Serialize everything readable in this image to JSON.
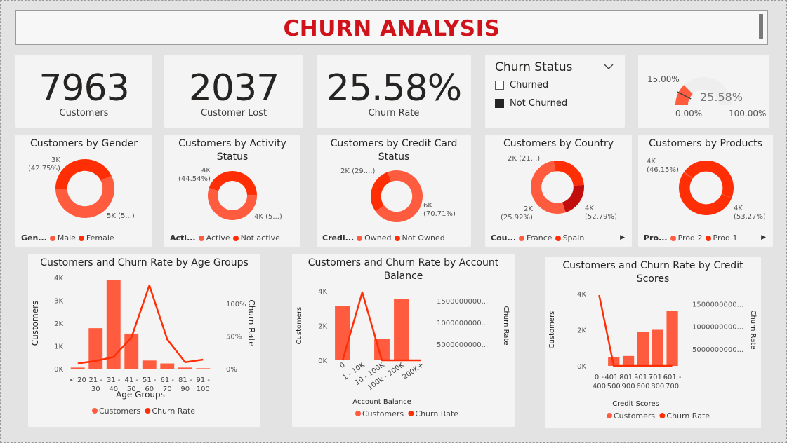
{
  "header": {
    "title": "CHURN ANALYSIS"
  },
  "colors": {
    "accent": "#ff5b3f",
    "accent_dark": "#ff2e05",
    "dark_red": "#c20d0d",
    "title_red": "#d0121b"
  },
  "kpis": [
    {
      "value": "7963",
      "label": "Customers"
    },
    {
      "value": "2037",
      "label": "Customer Lost"
    },
    {
      "value": "25.58%",
      "label": "Churn Rate"
    }
  ],
  "slicer": {
    "title": "Churn Status",
    "chevron_icon": "chevron-down-icon",
    "options": [
      {
        "label": "Churned",
        "selected": false
      },
      {
        "label": "Not Churned",
        "selected": true
      }
    ]
  },
  "gauge": {
    "target_label": "15.00%",
    "value_label": "25.58%",
    "min_label": "0.00%",
    "max_label": "100.00%",
    "value": 25.58,
    "target": 15,
    "min": 0,
    "max": 100
  },
  "more_options": "⋯",
  "donuts": [
    {
      "title": "Customers by Gender",
      "legend_title": "Gen...",
      "legend": [
        "Male",
        "Female"
      ],
      "labels": [
        "3K\n(42.75%)",
        "5K (5...)"
      ],
      "values": [
        42.75,
        57.25
      ]
    },
    {
      "title": "Customers by Activity Status",
      "legend_title": "Acti...",
      "legend": [
        "Active",
        "Not active"
      ],
      "labels": [
        "4K\n(44.54%)",
        "4K (5...)"
      ],
      "values": [
        44.54,
        55.46
      ]
    },
    {
      "title": "Customers by Credit Card Status",
      "legend_title": "Credi...",
      "legend": [
        "Owned",
        "Not Owned"
      ],
      "labels": [
        "2K (29....)",
        "6K\n(70.71%)"
      ],
      "values": [
        29.29,
        70.71
      ]
    },
    {
      "title": "Customers by Country",
      "legend_title": "Cou...",
      "legend": [
        "France",
        "Spain"
      ],
      "labels": [
        "2K (21...)",
        "2K\n(25.92%)",
        "4K\n(52.79%)"
      ],
      "values": [
        52.79,
        25.92,
        21.29
      ]
    },
    {
      "title": "Customers by Products",
      "legend_title": "Pro...",
      "legend": [
        "Prod 2",
        "Prod 1"
      ],
      "labels": [
        "4K\n(46.15%)",
        "4K\n(53.27%)"
      ],
      "values": [
        46.15,
        53.27,
        0.58
      ]
    }
  ],
  "chart_data": [
    {
      "type": "bar",
      "title": "Customers and Churn Rate by Age Groups",
      "xlabel": "Age Groups",
      "ylabel": "Customers",
      "y2label": "Churn Rate",
      "categories": [
        "< 20",
        "21 - 30",
        "31 - 40",
        "41 - 50",
        "51 - 60",
        "61 - 70",
        "81 - 90",
        "91 - 100"
      ],
      "yticks": [
        "0K",
        "1K",
        "2K",
        "3K",
        "4K"
      ],
      "y2ticks": [
        "0%",
        "50%",
        "100%"
      ],
      "ylim": [
        0,
        4000
      ],
      "y2lim": [
        0,
        140
      ],
      "series": [
        {
          "name": "Customers",
          "kind": "bar",
          "values": [
            50,
            1780,
            3900,
            1540,
            360,
            230,
            50,
            20
          ]
        },
        {
          "name": "Churn Rate",
          "kind": "line",
          "values": [
            8,
            12,
            18,
            48,
            128,
            45,
            10,
            14
          ]
        }
      ],
      "legend": [
        "Customers",
        "Churn Rate"
      ]
    },
    {
      "type": "bar",
      "title": "Customers and Churn Rate by Account Balance",
      "xlabel": "Account Balance",
      "ylabel": "Customers",
      "y2label": "Churn Rate",
      "categories": [
        "0",
        "1 - 10K",
        "10 - 100K",
        "100k - 200K",
        "200K+"
      ],
      "yticks": [
        "0K",
        "2K",
        "4K"
      ],
      "y2ticks": [
        "5000000000...",
        "1000000000...",
        "1500000000..."
      ],
      "ylim": [
        0,
        4000
      ],
      "series": [
        {
          "name": "Customers",
          "kind": "bar",
          "values": [
            3150,
            0,
            1250,
            3550,
            0
          ]
        },
        {
          "name": "Churn Rate",
          "kind": "line",
          "values": [
            0,
            1,
            0,
            0,
            0
          ]
        }
      ],
      "legend": [
        "Customers",
        "Churn Rate"
      ]
    },
    {
      "type": "bar",
      "title": "Customers and Churn Rate by Credit Scores",
      "xlabel": "Credit Scores",
      "ylabel": "Customers",
      "y2label": "Churn Rate",
      "categories": [
        "0 - 400",
        "401 - 500",
        "801 - 900",
        "501 - 600",
        "701 - 800",
        "601 - 700"
      ],
      "yticks": [
        "0K",
        "2K",
        "4K"
      ],
      "y2ticks": [
        "5000000000...",
        "1000000000...",
        "1500000000..."
      ],
      "ylim": [
        0,
        4000
      ],
      "series": [
        {
          "name": "Customers",
          "kind": "bar",
          "values": [
            0,
            500,
            550,
            1900,
            2000,
            3050
          ]
        },
        {
          "name": "Churn Rate",
          "kind": "line",
          "values": [
            1,
            0,
            0,
            0,
            0,
            0
          ]
        }
      ],
      "legend": [
        "Customers",
        "Churn Rate"
      ]
    }
  ]
}
